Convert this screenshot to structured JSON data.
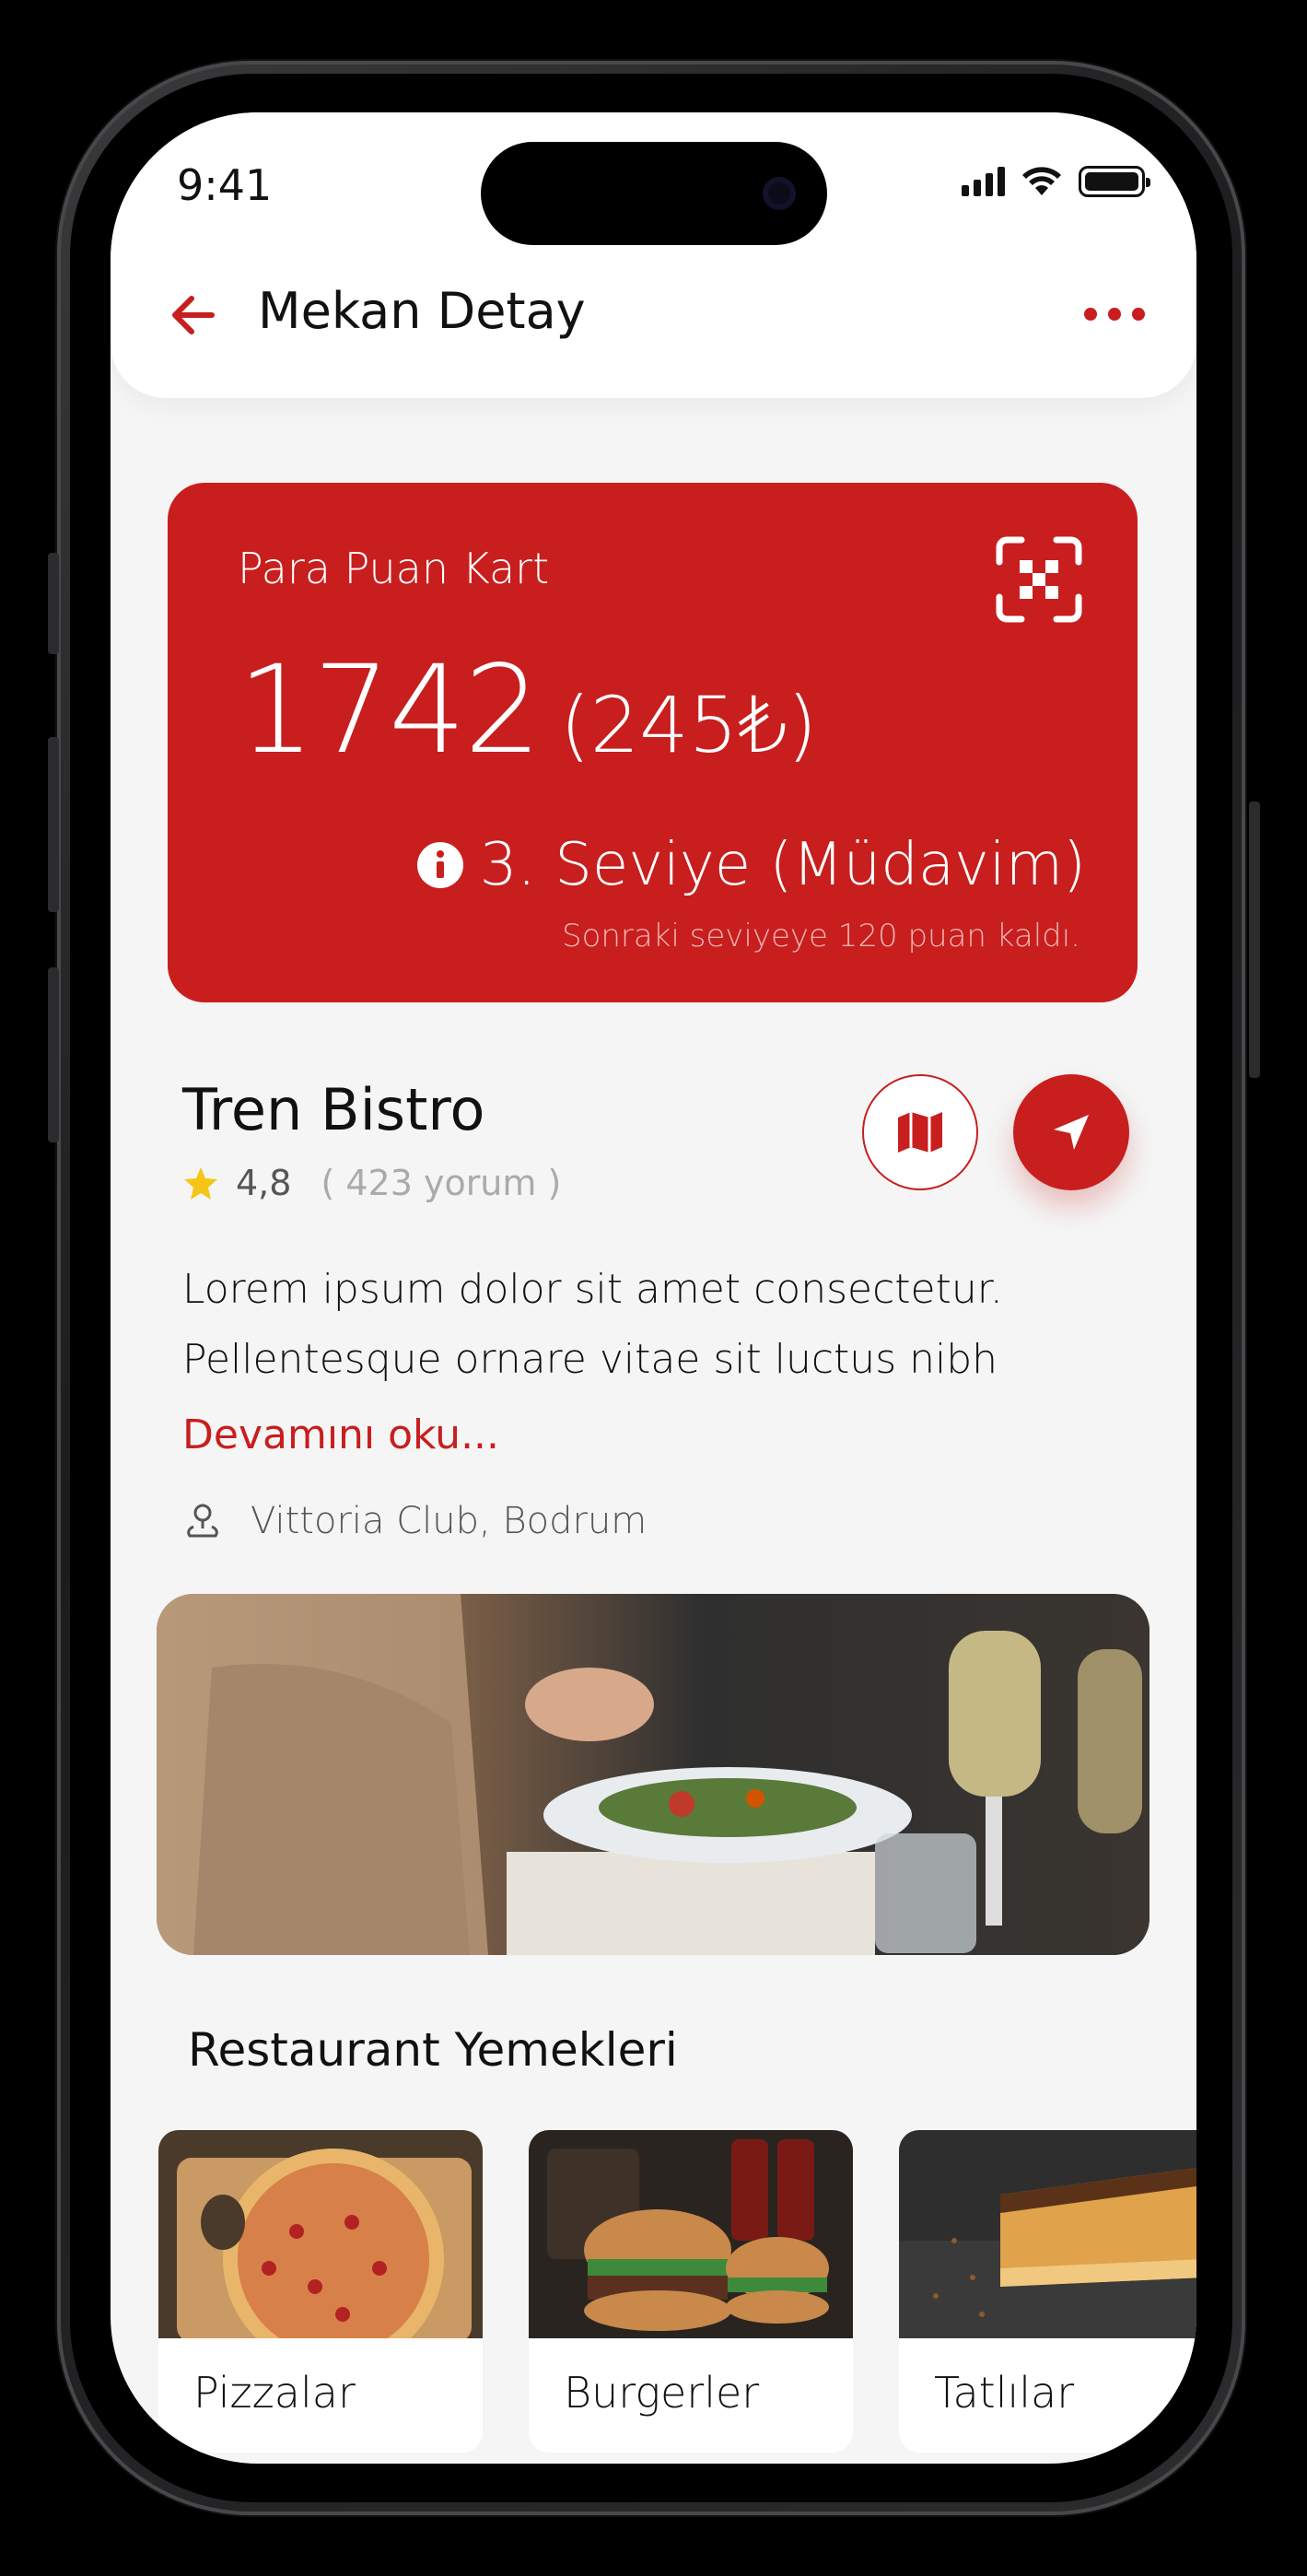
{
  "status_bar": {
    "time": "9:41"
  },
  "header": {
    "title": "Mekan Detay"
  },
  "loyalty_card": {
    "title": "Para Puan Kart",
    "points": "1742",
    "money": "(245₺)",
    "level": "3. Seviye (Müdavim)",
    "next_level": "Sonraki seviyeye 120 puan kaldı."
  },
  "restaurant": {
    "name": "Tren Bistro",
    "rating": "4,8",
    "reviews": "( 423 yorum )",
    "description": "Lorem ipsum dolor sit amet consectetur. Pellentesque ornare vitae sit luctus nibh",
    "read_more": "Devamını oku...",
    "location": "Vittoria Club, Bodrum"
  },
  "section": {
    "title": "Restaurant Yemekleri",
    "categories": [
      {
        "label": "Pizzalar"
      },
      {
        "label": "Burgerler"
      },
      {
        "label": "Tatlılar"
      }
    ]
  },
  "colors": {
    "accent": "#c81e1e",
    "background": "#f5f5f5",
    "star": "#f5c518"
  }
}
